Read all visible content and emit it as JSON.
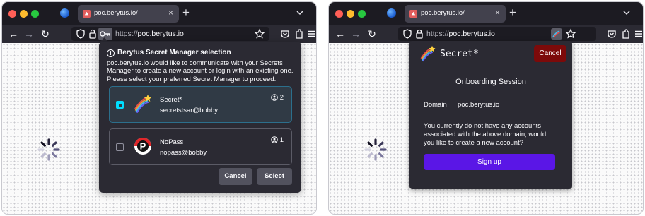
{
  "left_window": {
    "tab": {
      "title": "poc.berytus.io/",
      "close": "×"
    },
    "new_tab": "+",
    "url": {
      "scheme": "https://",
      "host": "poc.berytus.io"
    },
    "dialog": {
      "title": "Berytus Secret Manager selection",
      "message": "poc.berytus.io would like to communicate with your Secrets Manager to create a new account or login with an existing one. Please select your preferred Secret Manager to proceed.",
      "candidates": [
        {
          "name": "Secret*",
          "account": "secretstsar@bobby",
          "count": "2",
          "selected": true,
          "logo": "rainbow-star-icon"
        },
        {
          "name": "NoPass",
          "account": "nopass@bobby",
          "count": "1",
          "selected": false,
          "logo": "nopass-p-icon"
        }
      ],
      "cancel_label": "Cancel",
      "select_label": "Select"
    }
  },
  "right_window": {
    "tab": {
      "title": "poc.berytus.io/",
      "close": "×"
    },
    "new_tab": "+",
    "url": {
      "scheme": "https://",
      "host": "poc.berytus.io"
    },
    "panel": {
      "app_name": "Secret*",
      "cancel_label": "Cancel",
      "session_title": "Onboarding Session",
      "domain_label": "Domain",
      "domain_value": "poc.berytus.io",
      "message": "You currently do not have any accounts associated with the above domain, would you like to create a new account?",
      "signup_label": "Sign up"
    }
  },
  "colors": {
    "tabbar": "#1c1b22",
    "navbar": "#2b2a33",
    "accent_select": "#00ddff",
    "signup": "#5a16e6",
    "cancel_red": "#7c0a0a"
  }
}
